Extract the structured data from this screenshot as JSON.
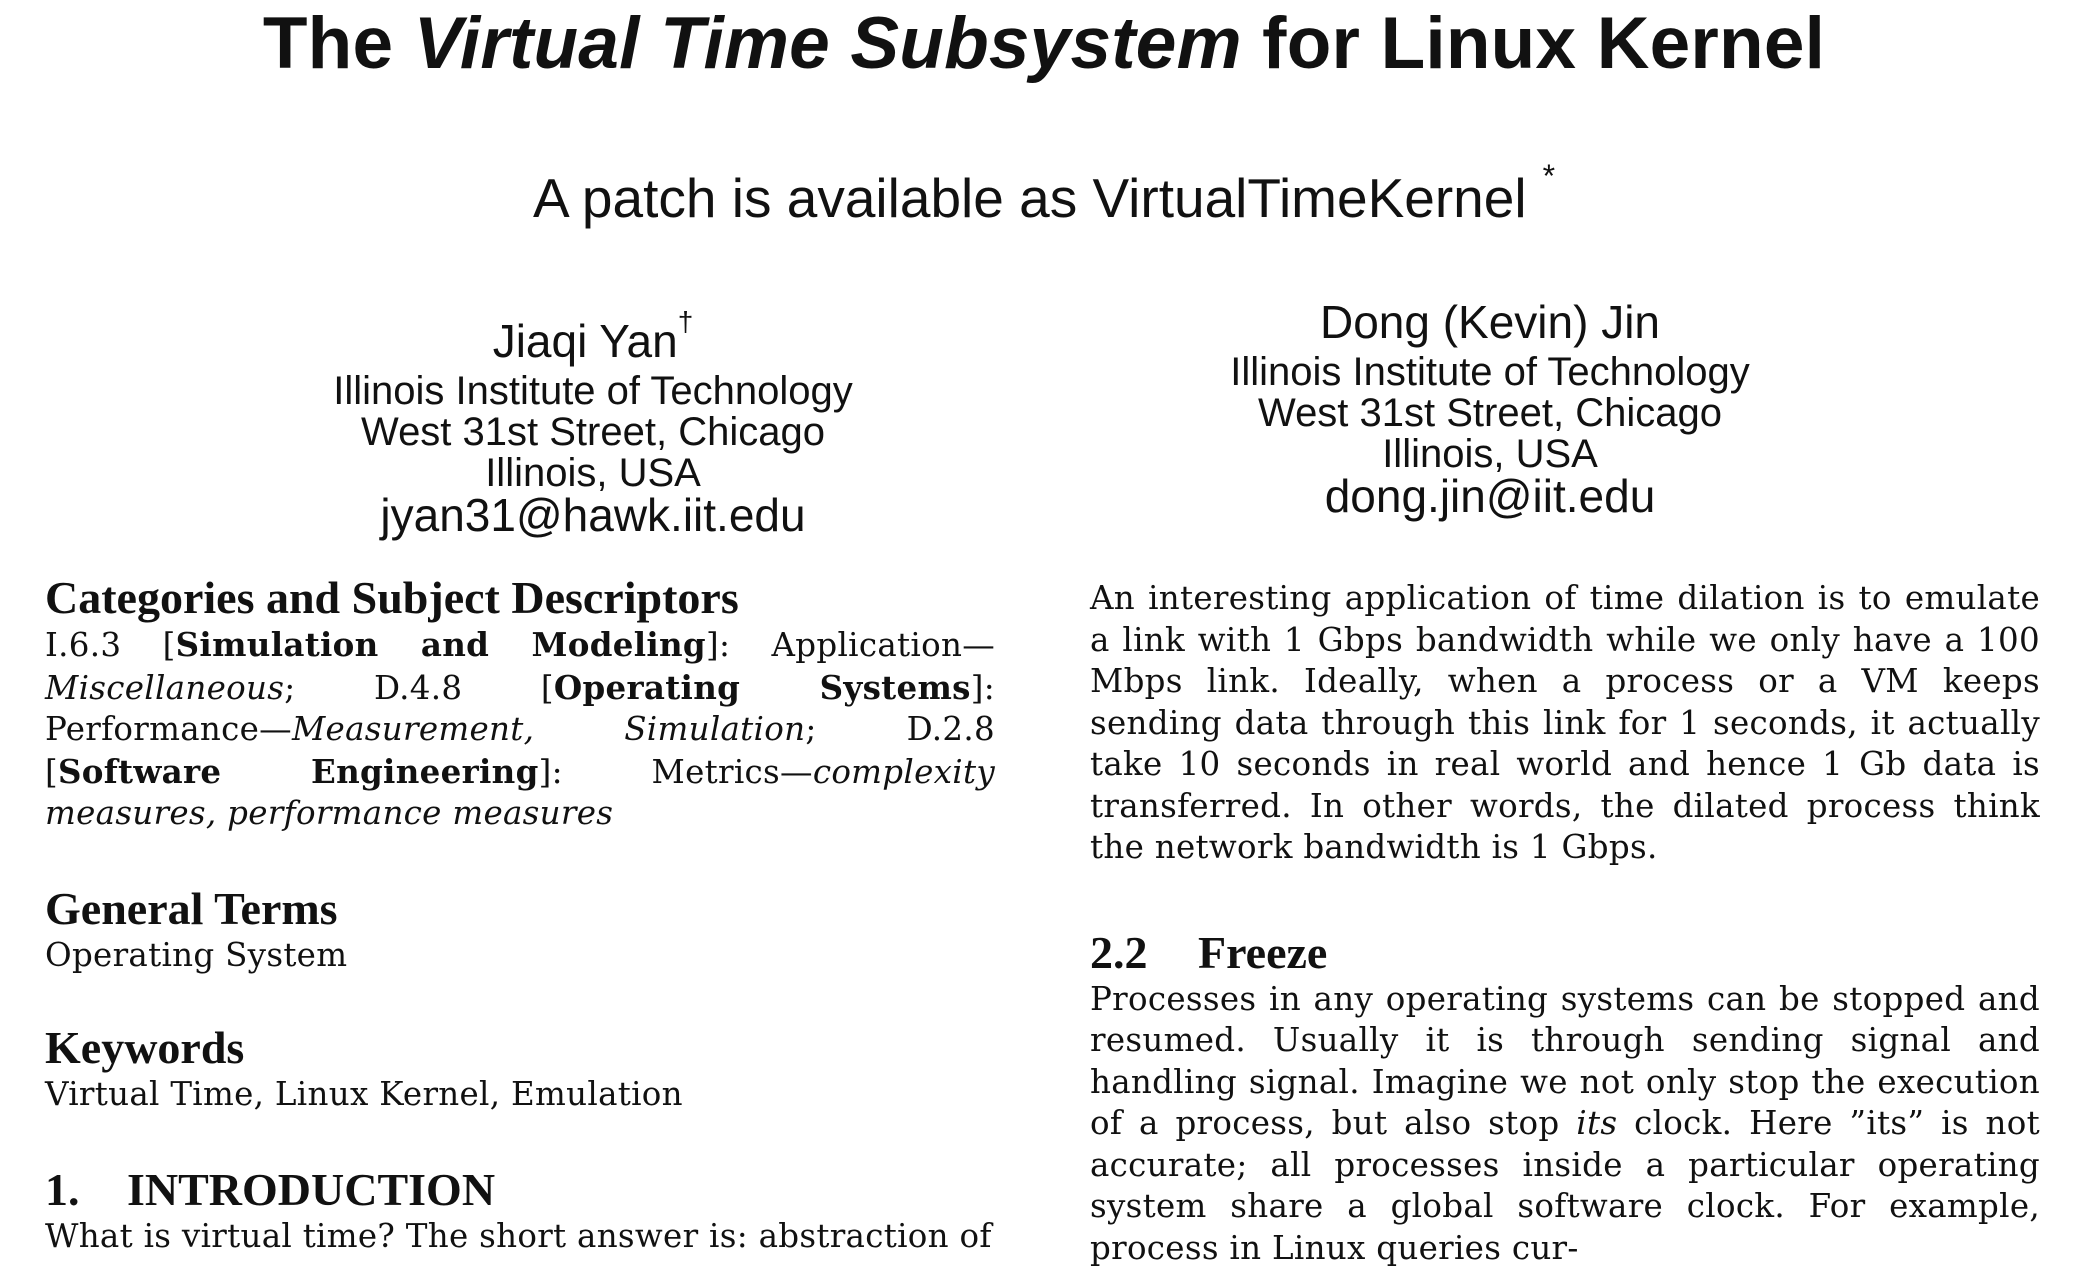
{
  "title": {
    "part1": "The ",
    "italic": "Virtual Time Subsystem",
    "part2": " for Linux Kernel"
  },
  "subtitle": {
    "text": "A patch is available as VirtualTimeKernel",
    "marker": "*"
  },
  "authors": [
    {
      "name": "Jiaqi Yan",
      "marker": "†",
      "affiliation": "Illinois Institute of Technology",
      "street": "West 31st Street, Chicago",
      "region": "Illinois, USA",
      "email": "jyan31@hawk.iit.edu"
    },
    {
      "name": "Dong (Kevin) Jin",
      "affiliation": "Illinois Institute of Technology",
      "street": "West 31st Street, Chicago",
      "region": "Illinois, USA",
      "email": "dong.jin@iit.edu"
    }
  ],
  "left_column": {
    "categories": {
      "heading": "Categories and Subject Descriptors",
      "parts": [
        "I.6.3 [",
        "Simulation and Modeling",
        "]: Application—",
        "Miscellaneous",
        "; D.4.8 [",
        "Operating Systems",
        "]: Performance—",
        "Measurement, Simulation",
        "; D.2.8 [",
        "Software Engineering",
        "]: Metrics—",
        "complexity measures, performance measures"
      ]
    },
    "general_terms": {
      "heading": "General Terms",
      "body": "Operating System"
    },
    "keywords": {
      "heading": "Keywords",
      "body": "Virtual Time, Linux Kernel, Emulation"
    },
    "introduction": {
      "number": "1.",
      "heading": "INTRODUCTION",
      "body": "What is virtual time? The short answer is: abstraction of"
    }
  },
  "right_column": {
    "paragraph": "An interesting application of time dilation is to emulate a link with 1 Gbps bandwidth while we only have a 100 Mbps link. Ideally, when a process or a VM keeps sending data through this link for 1 seconds, it actually take 10 seconds in real world and hence 1 Gb data is transferred. In other words, the dilated process think the network bandwidth is 1 Gbps.",
    "freeze": {
      "number": "2.2",
      "heading": "Freeze",
      "body_before_italic": "Processes in any operating systems can be stopped and resumed. Usually it is through sending signal and handling signal. Imagine we not only stop the execution of a process, but also stop ",
      "italic": "its",
      "body_after_italic": " clock. Here ”its” is not accurate; all processes inside a particular operating system share a global software clock. For example, process in Linux queries cur-"
    }
  }
}
